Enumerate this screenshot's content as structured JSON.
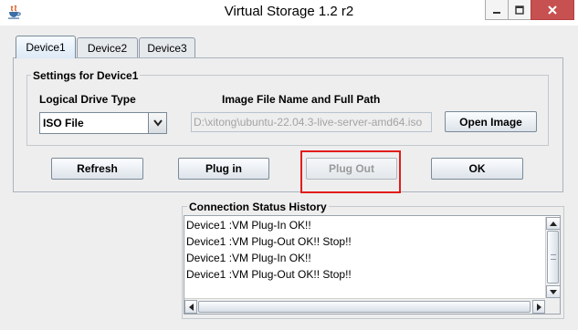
{
  "window": {
    "title": "Virtual Storage 1.2 r2"
  },
  "icons": {
    "app": "java-cup-icon",
    "minimize": "minimize-icon",
    "maximize": "maximize-icon",
    "close": "close-icon",
    "dropdown": "chevron-down-icon",
    "scroll_up": "triangle-up-icon",
    "scroll_down": "triangle-down-icon",
    "scroll_left": "triangle-left-icon",
    "scroll_right": "triangle-right-icon"
  },
  "tabs": [
    {
      "label": "Device1",
      "selected": true
    },
    {
      "label": "Device2",
      "selected": false
    },
    {
      "label": "Device3",
      "selected": false
    }
  ],
  "settings": {
    "legend": "Settings for Device1",
    "drive_type_label": "Logical Drive Type",
    "drive_type_value": "ISO File",
    "image_path_label": "Image File Name and Full Path",
    "image_path_value": "D:\\xitong\\ubuntu-22.04.3-live-server-amd64.iso",
    "open_image_label": "Open Image"
  },
  "buttons": {
    "refresh": "Refresh",
    "plug_in": "Plug in",
    "plug_out": "Plug Out",
    "ok": "OK"
  },
  "history": {
    "legend": "Connection Status History",
    "lines": [
      "Device1 :VM Plug-In OK!!",
      "Device1 :VM Plug-Out OK!! Stop!!",
      "Device1 :VM Plug-In OK!!",
      "Device1 :VM Plug-Out OK!! Stop!!"
    ]
  },
  "colors": {
    "highlight": "#e21c1c",
    "close_button": "#c75050",
    "disabled_text": "#9a9a9a"
  }
}
